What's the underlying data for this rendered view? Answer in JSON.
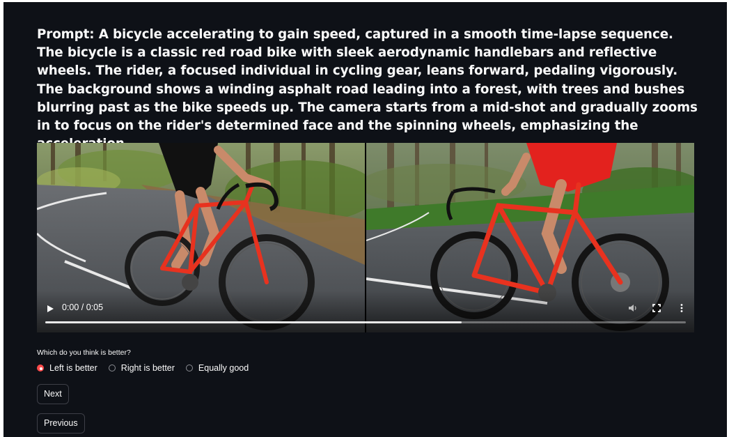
{
  "prompt": {
    "text": "Prompt: A bicycle accelerating to gain speed, captured in a smooth time-lapse sequence. The bicycle is a classic red road bike with sleek aerodynamic handlebars and reflective wheels. The rider, a focused individual in cycling gear, leans forward, pedaling vigorously. The background shows a winding asphalt road leading into a forest, with trees and bushes blurring past as the bike speeds up. The camera starts from a mid-shot and gradually zooms in to focus on the rider's determined face and the spinning wheels, emphasizing the acceleration."
  },
  "video": {
    "time": "0:00 / 0:05",
    "progress_fraction": 0.65,
    "icons": {
      "play": "play-icon",
      "volume": "volume-icon",
      "fullscreen": "fullscreen-icon",
      "more": "more-options-icon"
    },
    "left_clip": "red road bike with rider on forest road (left)",
    "right_clip": "red road bike with rider on forest road (right)"
  },
  "form": {
    "question": "Which do you think is better?",
    "options": [
      {
        "label": "Left is better",
        "checked": true
      },
      {
        "label": "Right is better",
        "checked": false
      },
      {
        "label": "Equally good",
        "checked": false
      }
    ],
    "next_label": "Next",
    "previous_label": "Previous"
  },
  "colors": {
    "background": "#0e1117",
    "accent": "#ff4b4b",
    "text": "#fafafa",
    "bike_red": "#e8321f"
  }
}
